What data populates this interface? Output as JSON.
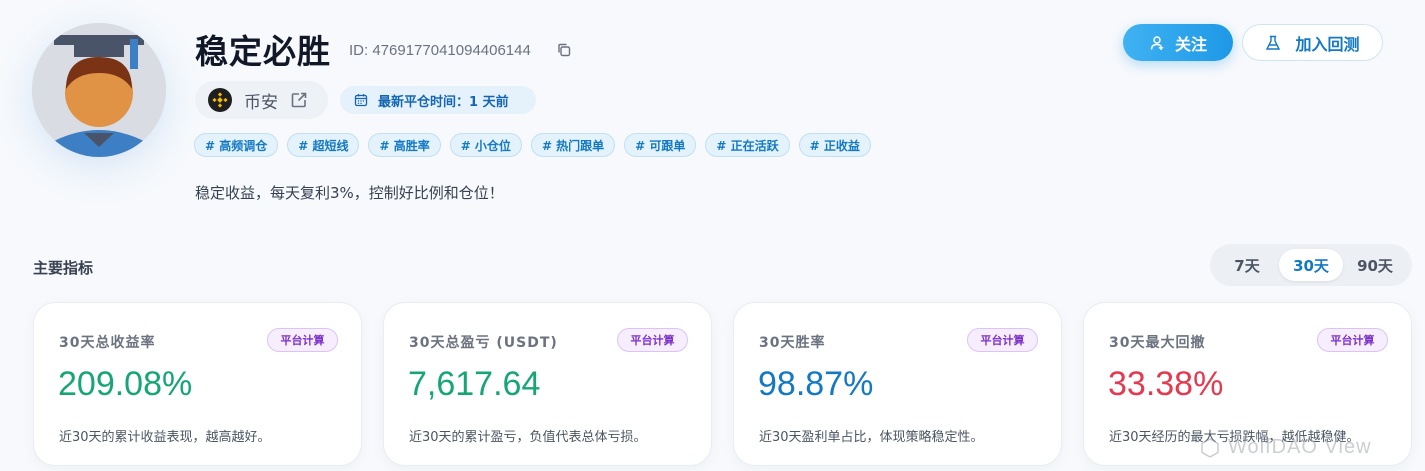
{
  "profile": {
    "name": "稳定必胜",
    "id_text": "ID: 4769177041094406144",
    "exchange": "币安",
    "last_close_label": "最新平仓时间：1 天前",
    "tags": [
      "# 高频调仓",
      "# 超短线",
      "# 高胜率",
      "# 小仓位",
      "# 热门跟单",
      "# 可跟单",
      "# 正在活跃",
      "# 正收益"
    ],
    "description": "稳定收益，每天复利3%，控制好比例和仓位！"
  },
  "actions": {
    "follow_label": "关注",
    "backtest_label": "加入回测"
  },
  "metrics": {
    "title": "主要指标",
    "ranges": [
      "7天",
      "30天",
      "90天"
    ],
    "active_range": "30天",
    "cards": [
      {
        "label": "30天总收益率",
        "badge": "平台计算",
        "value": "209.08%",
        "note": "近30天的累计收益表现，越高越好。",
        "color": "#16a676"
      },
      {
        "label": "30天总盈亏 (USDT)",
        "badge": "平台计算",
        "value": "7,617.64",
        "note": "近30天的累计盈亏，负值代表总体亏损。",
        "color": "#16a676"
      },
      {
        "label": "30天胜率",
        "badge": "平台计算",
        "value": "98.87%",
        "note": "近30天盈利单占比，体现策略稳定性。",
        "color": "#1479c4"
      },
      {
        "label": "30天最大回撤",
        "badge": "平台计算",
        "value": "33.38%",
        "note": "近30天经历的最大亏损跌幅，越低越稳健。",
        "color": "#e5394f"
      }
    ]
  },
  "watermark": "WolfDAO View"
}
